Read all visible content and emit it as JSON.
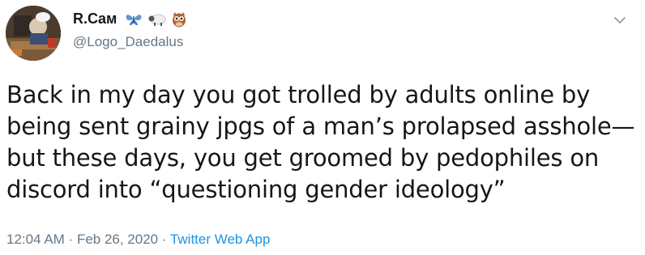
{
  "author": {
    "display_name": "R.Cам",
    "handle": "@Logo_Daedalus",
    "name_emojis": [
      "butterfly-icon",
      "sheep-icon",
      "owl-icon"
    ]
  },
  "tweet": {
    "text_lines": [
      "Back in my day you got trolled by adults online by",
      "being sent grainy jpgs of a man’s prolapsed asshole—",
      "but these days, you get groomed by pedophiles on",
      "discord into “questioning gender ideology”"
    ]
  },
  "meta": {
    "time": "12:04 AM",
    "separator": " · ",
    "date": "Feb 26, 2020",
    "source": "Twitter Web App"
  },
  "colors": {
    "text": "#14171a",
    "secondary": "#657786",
    "link": "#1b95e0"
  }
}
